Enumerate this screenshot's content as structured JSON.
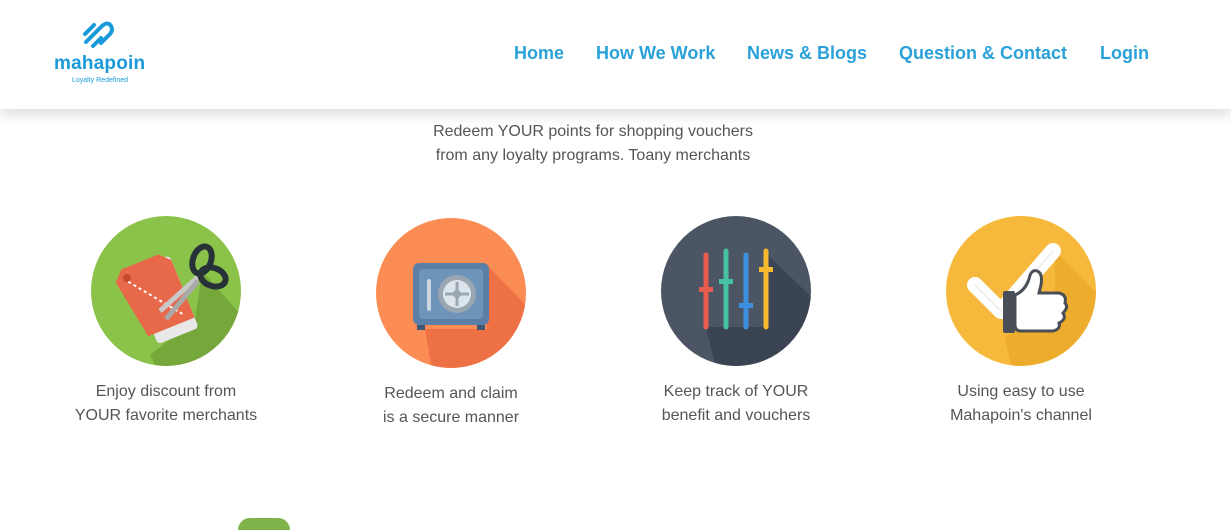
{
  "brand": {
    "name": "mahapoin",
    "tagline": "Loyalty Redefined",
    "color": "#1a9ad9"
  },
  "nav": {
    "items": [
      {
        "label": "Home"
      },
      {
        "label": "How We Work"
      },
      {
        "label": "News & Blogs"
      },
      {
        "label": "Question & Contact"
      },
      {
        "label": "Login"
      }
    ],
    "color": "#2aa1d8"
  },
  "intro": {
    "line1": "Redeem YOUR points for shopping vouchers",
    "line2": "from any loyalty programs. Toany merchants"
  },
  "features": [
    {
      "icon": "price-tag-scissors-icon",
      "line1": "Enjoy discount from",
      "line2": "YOUR favorite merchants",
      "color": "#8bc34a"
    },
    {
      "icon": "safe-icon",
      "line1": "Redeem and claim",
      "line2": "is a secure manner",
      "color": "#fb8c53"
    },
    {
      "icon": "equalizer-sliders-icon",
      "line1": "Keep track of YOUR",
      "line2": "benefit and vouchers",
      "color": "#4b5563"
    },
    {
      "icon": "checkmark-thumbs-up-icon",
      "line1": "Using easy to use",
      "line2": "Mahapoin's channel",
      "color": "#f6b93b"
    }
  ]
}
